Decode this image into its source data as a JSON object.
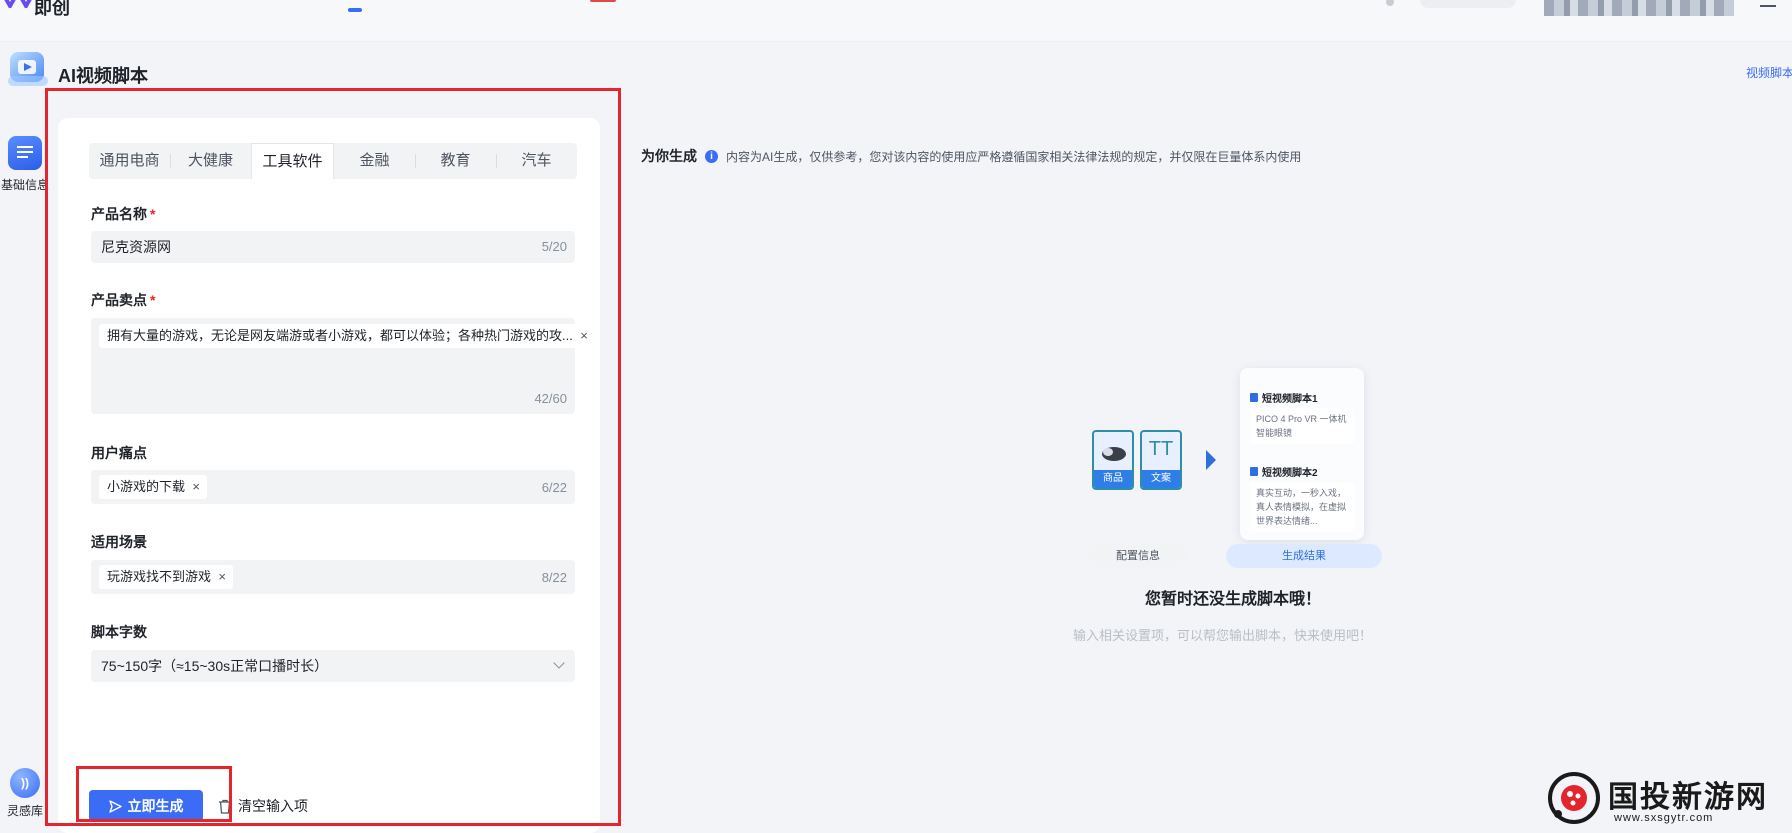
{
  "topbar": {
    "logo_text": "即创"
  },
  "header": {
    "title": "AI视频脚本",
    "right_link": "视频脚本"
  },
  "rail": {
    "basic_label": "基础信息",
    "inspire_label": "灵感库",
    "inspire_icon_text": "))"
  },
  "tabs": [
    "通用电商",
    "大健康",
    "工具软件",
    "金融",
    "教育",
    "汽车"
  ],
  "active_tab": "工具软件",
  "form": {
    "product_name": {
      "label": "产品名称",
      "required": "*",
      "value": "尼克资源网",
      "counter": "5/20"
    },
    "selling_points": {
      "label": "产品卖点",
      "required": "*",
      "chip": "拥有大量的游戏，无论是网友端游或者小游戏，都可以体验；各种热门游戏的攻...",
      "counter": "42/60"
    },
    "pain_points": {
      "label": "用户痛点",
      "chip": "小游戏的下载",
      "counter": "6/22"
    },
    "scenario": {
      "label": "适用场景",
      "chip": "玩游戏找不到游戏",
      "counter": "8/22"
    },
    "word_count": {
      "label": "脚本字数",
      "value": "75~150字（≈15~30s正常口播时长）"
    },
    "chip_close": "×"
  },
  "actions": {
    "generate": "立即生成",
    "clear": "清空输入项"
  },
  "result": {
    "title": "为你生成",
    "notice": "内容为AI生成，仅供参考，您对该内容的使用应严格遵循国家相关法律法规的规定，并仅限在巨量体系内使用",
    "illustration": {
      "card_product": "商品",
      "card_copy": "文案",
      "copy_glyph": "TT",
      "script1_title": "短视频脚本1",
      "script1_body": "PICO 4 Pro VR 一体机智能眼镜",
      "script2_title": "短视频脚本2",
      "script2_body": "真实互动，一秒入戏，真人表情模拟，在虚拟世界表达情绪...",
      "pill_config": "配置信息",
      "pill_result": "生成结果"
    },
    "empty_title": "您暂时还没生成脚本哦！",
    "empty_sub": "输入相关设置项，可以帮您输出脚本，快来使用吧！"
  },
  "watermark": {
    "name": "国投新游网",
    "url": "www.sxsgytr.com"
  },
  "colors": {
    "accent": "#3b6cf6",
    "highlight_frame": "#e3262d",
    "required": "#e3262d"
  }
}
